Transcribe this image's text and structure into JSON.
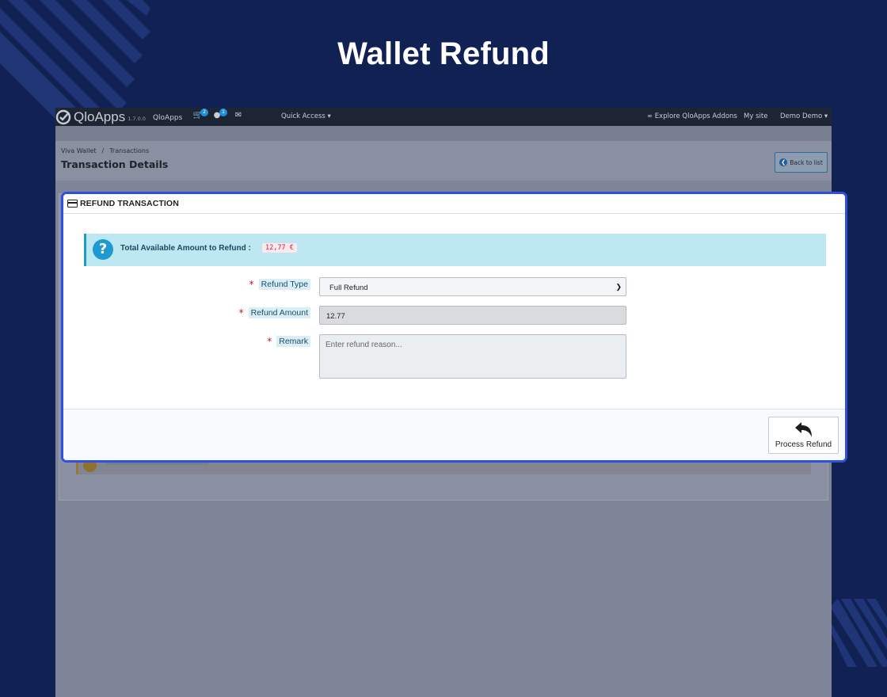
{
  "page": {
    "hero_title": "Wallet Refund"
  },
  "topbar": {
    "brand_name": "QloApps",
    "version": "1.7.0.0",
    "brand_link": "QloApps",
    "cart_badge": "2",
    "customer_badge": "1",
    "quick_access": "Quick Access",
    "explore_addons": "Explore QloApps Addons",
    "my_site": "My site",
    "user_menu": "Demo Demo"
  },
  "header": {
    "breadcrumb": [
      "Viva Wallet",
      "Transactions"
    ],
    "title": "Transaction Details",
    "back_button": "Back to list"
  },
  "modal": {
    "title": "REFUND TRANSACTION",
    "info_label": "Total Available Amount to Refund :",
    "info_amount": "12,77 €",
    "fields": {
      "refund_type_label": "Refund Type",
      "refund_type_value": "Full Refund",
      "refund_amount_label": "Refund Amount",
      "refund_amount_value": "12.77",
      "remark_label": "Remark",
      "remark_placeholder": "Enter refund reason..."
    },
    "required_marker": "*",
    "process_button": "Process Refund"
  },
  "colors": {
    "background": "#122154",
    "modal_border": "#2f4fe0",
    "info_bg": "#bde8f1",
    "amount_text": "#c7254e"
  }
}
